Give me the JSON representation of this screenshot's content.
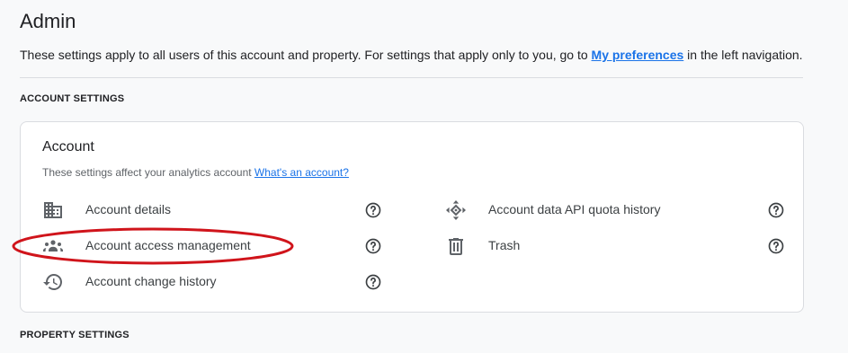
{
  "header": {
    "title": "Admin",
    "intro_prefix": "These settings apply to all users of this account and property. For settings that apply only to you, go to ",
    "intro_link": "My preferences",
    "intro_suffix": " in the left navigation."
  },
  "sections": {
    "account_settings": "ACCOUNT SETTINGS",
    "property_settings": "PROPERTY SETTINGS"
  },
  "account_card": {
    "title": "Account",
    "subtitle": "These settings affect your analytics account ",
    "subtitle_link": "What's an account?",
    "items": [
      {
        "label": "Account details",
        "icon": "building-icon"
      },
      {
        "label": "Account access management",
        "icon": "people-group-icon"
      },
      {
        "label": "Account change history",
        "icon": "history-icon"
      },
      {
        "label": "Account data API quota history",
        "icon": "api-arrows-icon"
      },
      {
        "label": "Trash",
        "icon": "trash-icon"
      }
    ]
  },
  "colors": {
    "link": "#1a73e8",
    "annotation": "#d0141b",
    "background": "#f8f9fa"
  }
}
